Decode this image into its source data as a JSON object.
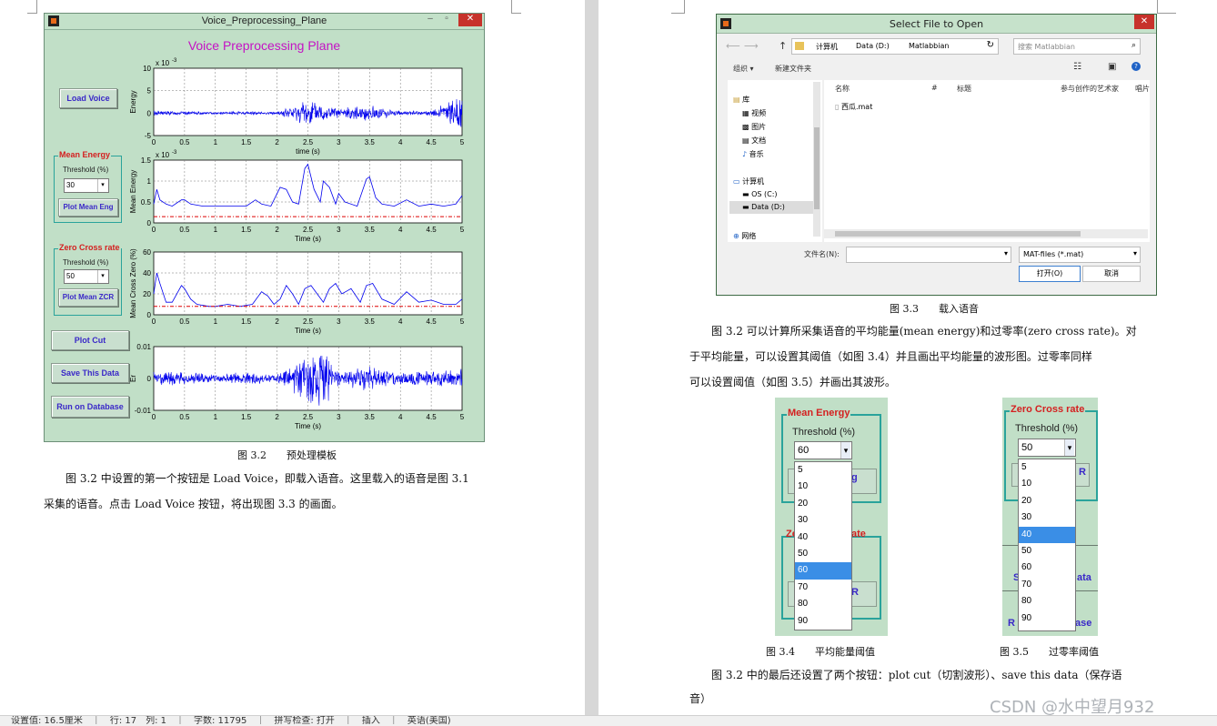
{
  "matlab_window": {
    "title": "Voice_Preprocessing_Plane",
    "heading": "Voice Preprocessing Plane",
    "buttons": {
      "load_voice": "Load Voice",
      "plot_mean_eng": "Plot Mean Eng",
      "plot_mean_zcr": "Plot Mean ZCR",
      "plot_cut": "Plot Cut",
      "save_data": "Save This Data",
      "run_database": "Run on Database"
    },
    "mean_energy": {
      "label": "Mean Energy",
      "threshold_label": "Threshold (%)",
      "value": "30"
    },
    "zero_cross": {
      "label": "Zero Cross rate",
      "threshold_label": "Threshold (%)",
      "value": "50"
    },
    "plots": [
      {
        "ylabel": "Energy",
        "xlabel": "time (s)",
        "exp": "x 10",
        "exp_pow": "-3",
        "yticks": [
          "10",
          "5",
          "0",
          "-5"
        ],
        "ylim": [
          -5,
          10
        ],
        "threshold": null
      },
      {
        "ylabel": "Mean Energy",
        "xlabel": "Time (s)",
        "exp": "x 10",
        "exp_pow": "-3",
        "yticks": [
          "1.5",
          "1",
          "0.5",
          "0"
        ],
        "ylim": [
          0,
          1.5
        ],
        "threshold": 0.15
      },
      {
        "ylabel": "Mean Cross Zero (%)",
        "xlabel": "Time (s)",
        "exp": "",
        "exp_pow": "",
        "yticks": [
          "60",
          "40",
          "20",
          "0"
        ],
        "ylim": [
          0,
          60
        ],
        "threshold": 8
      },
      {
        "ylabel": "Er",
        "xlabel": "Time (s)",
        "exp": "",
        "exp_pow": "",
        "yticks": [
          "0.01",
          "0",
          "-0.01"
        ],
        "ylim": [
          -0.01,
          0.01
        ],
        "threshold": null
      }
    ],
    "xticks": [
      "0",
      "0.5",
      "1",
      "1.5",
      "2",
      "2.5",
      "3",
      "3.5",
      "4",
      "4.5",
      "5"
    ]
  },
  "chart_data": [
    {
      "type": "line",
      "title": "",
      "xlabel": "time (s)",
      "ylabel": "Energy",
      "xlim": [
        0,
        5
      ],
      "ylim": [
        -5,
        10
      ],
      "grid": true,
      "series": [
        {
          "x": [
            0,
            0.5,
            1,
            1.5,
            2,
            2.5,
            3,
            3.5,
            4,
            4.5,
            5
          ],
          "values": [
            0.5,
            0.3,
            0.2,
            0.3,
            0.2,
            2.5,
            0.8,
            1.4,
            0.4,
            0.4,
            3.5
          ]
        }
      ]
    },
    {
      "type": "line",
      "title": "",
      "xlabel": "Time (s)",
      "ylabel": "Mean Energy",
      "xlim": [
        0,
        5
      ],
      "ylim": [
        0,
        1.5
      ],
      "grid": true,
      "series": [
        {
          "x": [
            0,
            0.05,
            0.1,
            0.2,
            0.3,
            0.45,
            0.5,
            0.6,
            0.8,
            1.0,
            1.2,
            1.5,
            1.65,
            1.75,
            1.9,
            2.05,
            2.15,
            2.25,
            2.35,
            2.45,
            2.5,
            2.6,
            2.7,
            2.75,
            2.85,
            2.95,
            3.0,
            3.1,
            3.3,
            3.45,
            3.5,
            3.6,
            3.7,
            3.9,
            4.1,
            4.3,
            4.5,
            4.7,
            4.9,
            5.0
          ],
          "values": [
            0.45,
            0.8,
            0.55,
            0.45,
            0.4,
            0.55,
            0.55,
            0.45,
            0.4,
            0.4,
            0.4,
            0.4,
            0.55,
            0.45,
            0.4,
            0.85,
            0.8,
            0.5,
            0.45,
            1.3,
            1.4,
            0.8,
            0.5,
            1.0,
            0.85,
            0.45,
            0.7,
            0.5,
            0.4,
            1.05,
            1.1,
            0.6,
            0.45,
            0.4,
            0.55,
            0.4,
            0.45,
            0.4,
            0.45,
            0.65
          ]
        },
        {
          "x": [
            0,
            5
          ],
          "values": [
            0.15,
            0.15
          ]
        }
      ]
    },
    {
      "type": "line",
      "title": "",
      "xlabel": "Time (s)",
      "ylabel": "Mean Cross Zero (%)",
      "xlim": [
        0,
        5
      ],
      "ylim": [
        0,
        60
      ],
      "grid": true,
      "series": [
        {
          "x": [
            0,
            0.05,
            0.1,
            0.2,
            0.3,
            0.45,
            0.5,
            0.6,
            0.7,
            0.9,
            1.0,
            1.2,
            1.4,
            1.6,
            1.75,
            1.85,
            1.95,
            2.05,
            2.15,
            2.25,
            2.35,
            2.45,
            2.55,
            2.65,
            2.75,
            2.85,
            2.95,
            3.05,
            3.2,
            3.35,
            3.45,
            3.55,
            3.7,
            3.9,
            4.1,
            4.3,
            4.5,
            4.7,
            4.9,
            5.0
          ],
          "values": [
            20,
            40,
            30,
            12,
            12,
            28,
            25,
            15,
            10,
            8,
            8,
            10,
            8,
            10,
            22,
            18,
            10,
            15,
            28,
            20,
            10,
            25,
            28,
            20,
            12,
            25,
            30,
            20,
            25,
            12,
            28,
            30,
            15,
            10,
            22,
            12,
            14,
            10,
            10,
            15
          ]
        },
        {
          "x": [
            0,
            5
          ],
          "values": [
            8,
            8
          ]
        }
      ]
    },
    {
      "type": "line",
      "title": "",
      "xlabel": "Time (s)",
      "ylabel": "Er",
      "xlim": [
        0,
        5
      ],
      "ylim": [
        -0.01,
        0.01
      ],
      "grid": true,
      "series": [
        {
          "x": [
            0,
            0.5,
            1,
            1.5,
            2,
            2.5,
            2.75,
            3,
            3.5,
            4,
            4.5,
            5
          ],
          "values": [
            0.002,
            0.0015,
            0.001,
            0.0015,
            0.001,
            0.006,
            0.007,
            0.002,
            0.003,
            0.0015,
            0.002,
            0.0025
          ]
        }
      ]
    }
  ],
  "captions": {
    "fig32": "图 3.2　　预处理模板",
    "fig33": "图 3.3　　载入语音",
    "fig34": "图 3.4　　平均能量阈值",
    "fig35": "图 3.5　　过零率阈值"
  },
  "paragraphs": {
    "left_1": "　　图 3.2 中设置的第一个按钮是 Load Voice，即载入语音。这里载入的语音是图 3.1",
    "left_2": "采集的语音。点击 Load Voice 按钮，将出现图 3.3 的画面。",
    "right_1": "　　图 3.2 可以计算所采集语音的平均能量(mean energy)和过零率(zero cross rate)。对",
    "right_2": "于平均能量，可以设置其阈值（如图 3.4）并且画出平均能量的波形图。过零率同样",
    "right_3": "可以设置阈值（如图 3.5）并画出其波形。",
    "right_4": "　　图 3.2 中的最后还设置了两个按钮：plot cut（切割波形）、save this data（保存语",
    "right_5": "音）"
  },
  "file_dialog": {
    "title": "Select File to Open",
    "path": [
      "计算机",
      "Data (D:)",
      "Matlabbian"
    ],
    "search_placeholder": "搜索 Matlabbian",
    "organize": "组织 ▾",
    "new_folder": "新建文件夹",
    "columns": [
      "名称",
      "#",
      "标题",
      "参与创作的艺术家",
      "唱片"
    ],
    "sidebar": [
      "库",
      "视频",
      "图片",
      "文档",
      "音乐",
      "计算机",
      "OS (C:)",
      "Data (D:)",
      "网络"
    ],
    "file": "西瓜.mat",
    "filename_label": "文件名(N):",
    "filter": "MAT-files (*.mat)",
    "open_btn": "打开(O)",
    "cancel_btn": "取消"
  },
  "zoom_mean": {
    "group_label": "Mean Energy",
    "threshold_label": "Threshold (%)",
    "selected": "60",
    "options": [
      "5",
      "10",
      "20",
      "30",
      "40",
      "50",
      "60",
      "70",
      "80",
      "90"
    ],
    "peek_bottom": "Ze",
    "peek_bottom2": "ate",
    "peek_btn": "R",
    "peek_btn_top": "g"
  },
  "zoom_zero": {
    "group_label": "Zero Cross rate",
    "threshold_label": "Threshold (%)",
    "selected": "50",
    "highlighted": "40",
    "options": [
      "5",
      "10",
      "20",
      "30",
      "40",
      "50",
      "60",
      "70",
      "80",
      "90"
    ],
    "peek_r": "R",
    "peek_s": "S",
    "peek_ata": "ata",
    "peek_r2": "R",
    "peek_ase": "ase"
  },
  "status_bar": "设置值: 16.5厘米　｜　行: 17　列: 1　｜　字数: 11795　｜　拼写检查: 打开　｜　插入　｜　英语(美国)",
  "watermark": "CSDN @水中望月932"
}
